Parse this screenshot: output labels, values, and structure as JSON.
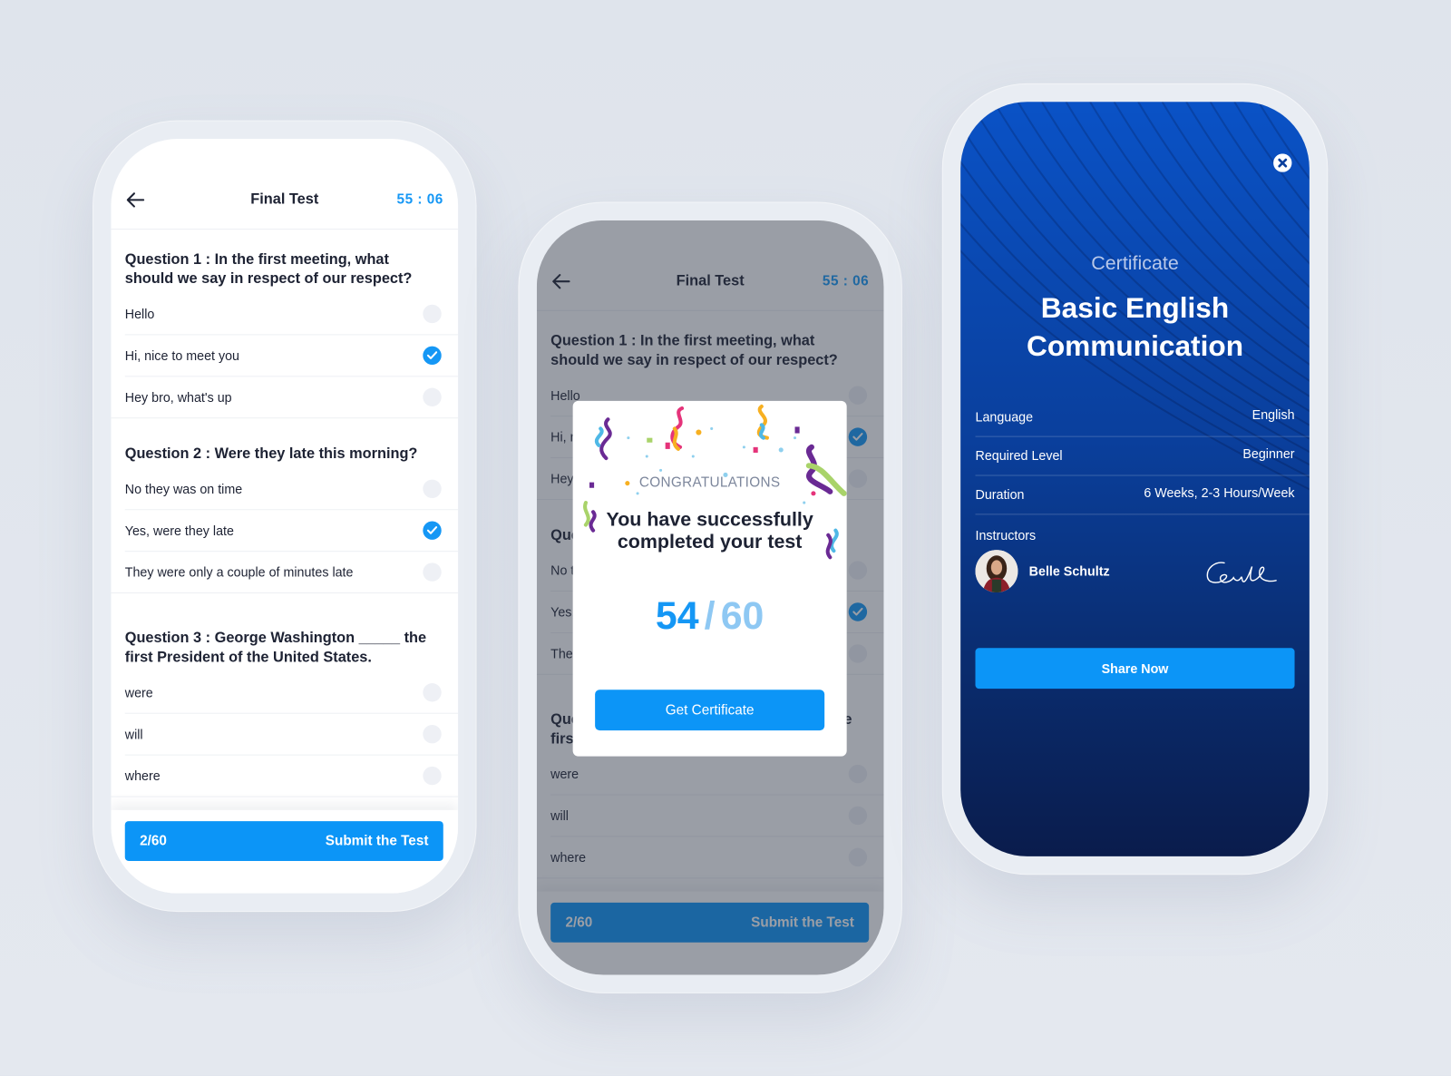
{
  "quiz": {
    "title": "Final Test",
    "timer": "55 : 06",
    "questions": [
      {
        "text": "Question 1 : In the first meeting, what should we say in respect of our respect?",
        "options": [
          {
            "label": "Hello",
            "checked": false
          },
          {
            "label": "Hi, nice to meet you",
            "checked": true
          },
          {
            "label": "Hey bro, what's up",
            "checked": false
          }
        ]
      },
      {
        "text": "Question 2 : Were they late this morning?",
        "options": [
          {
            "label": "No they was on time",
            "checked": false
          },
          {
            "label": "Yes, were they late",
            "checked": true
          },
          {
            "label": "They were only a couple of minutes late",
            "checked": false
          }
        ]
      },
      {
        "text": "Question 3 : George Washington _____ the first President of the United States.",
        "options": [
          {
            "label": "were",
            "checked": false
          },
          {
            "label": "will",
            "checked": false
          },
          {
            "label": "where",
            "checked": false
          }
        ]
      }
    ],
    "progress": "2/60",
    "submit_label": "Submit the Test"
  },
  "result_modal": {
    "heading": "CONGRATULATIONS",
    "message": "You have successfully completed your test",
    "score": "54",
    "separator": "/",
    "total": "60",
    "button_label": "Get Certificate"
  },
  "certificate": {
    "subtitle": "Certificate",
    "course_title": "Basic English Communication",
    "details": [
      {
        "label": "Language",
        "value": "English"
      },
      {
        "label": "Required Level",
        "value": "Beginner"
      },
      {
        "label": "Duration",
        "value": "6 Weeks, 2-3 Hours/Week"
      }
    ],
    "instructors_label": "Instructors",
    "instructor_name": "Belle Schultz",
    "share_label": "Share Now"
  },
  "colors": {
    "accent": "#0c95f7",
    "certificate_bg": "#0a3f9c",
    "text": "#1d2233"
  }
}
